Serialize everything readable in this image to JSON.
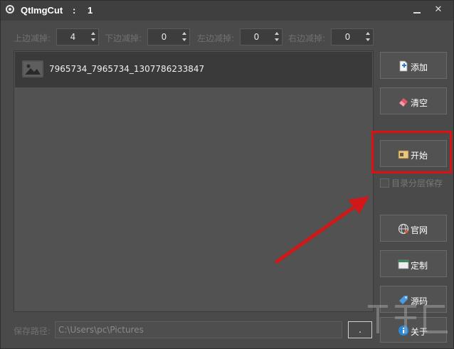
{
  "titlebar": {
    "app_name": "QtImgCut",
    "separator": ":",
    "count": "1",
    "minimize_icon": "minimize-icon",
    "close_label": "✕"
  },
  "margins": {
    "top_label": "上边减掉:",
    "top_value": "4",
    "bottom_label": "下边减掉:",
    "bottom_value": "0",
    "left_label": "左边减掉:",
    "left_value": "0",
    "right_label": "右边减掉:",
    "right_value": "0"
  },
  "filelist": {
    "items": [
      {
        "name": "7965734_7965734_1307786233847",
        "icon": "image-icon"
      }
    ]
  },
  "buttons": {
    "add": "添加",
    "clear": "清空",
    "start": "开始",
    "dir_layer_save": "目录分层保存",
    "website": "官网",
    "customize": "定制",
    "source": "源码",
    "about": "关于"
  },
  "save": {
    "label": "保存路径:",
    "path": "C:\\Users\\pc\\Pictures",
    "browse": "."
  },
  "colors": {
    "background": "#4a4a4a",
    "highlight": "#e01010",
    "arrow": "#d01818"
  }
}
